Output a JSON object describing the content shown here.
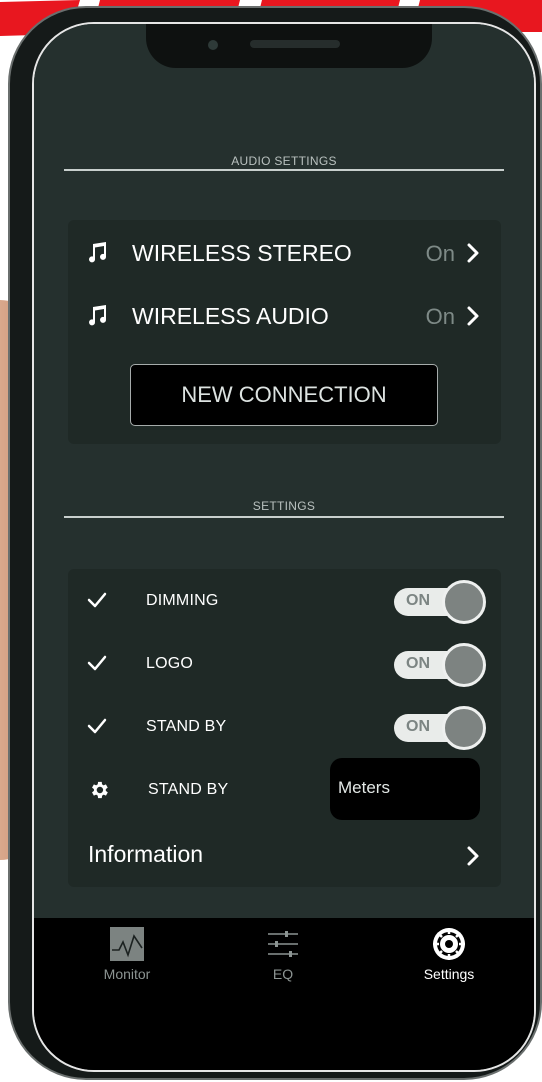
{
  "audio_settings": {
    "section_title": "AUDIO SETTINGS",
    "items": [
      {
        "label": "WIRELESS STEREO",
        "state": "On",
        "icon": "music-note-icon"
      },
      {
        "label": "WIRELESS AUDIO",
        "state": "On",
        "icon": "music-note-icon"
      }
    ],
    "new_connection_label": "NEW CONNECTION"
  },
  "settings": {
    "section_title": "SETTINGS",
    "toggles": [
      {
        "label": "DIMMING",
        "value": "ON",
        "icon": "check-icon"
      },
      {
        "label": "LOGO",
        "value": "ON",
        "icon": "check-icon"
      },
      {
        "label": "STAND BY",
        "value": "ON",
        "icon": "check-icon"
      }
    ],
    "standby_select": {
      "label": "STAND BY",
      "value": "Meters",
      "icon": "gear-icon"
    },
    "information_label": "Information"
  },
  "tabs": [
    {
      "label": "Monitor",
      "icon": "monitor-chart-icon",
      "active": false
    },
    {
      "label": "EQ",
      "icon": "equalizer-sliders-icon",
      "active": false
    },
    {
      "label": "Settings",
      "icon": "settings-gear-icon",
      "active": true
    }
  ],
  "colors": {
    "screen_bg": "#25302e",
    "card_bg": "#1f2926",
    "tabbar_bg": "#000000",
    "brand_red": "#e8171f"
  }
}
